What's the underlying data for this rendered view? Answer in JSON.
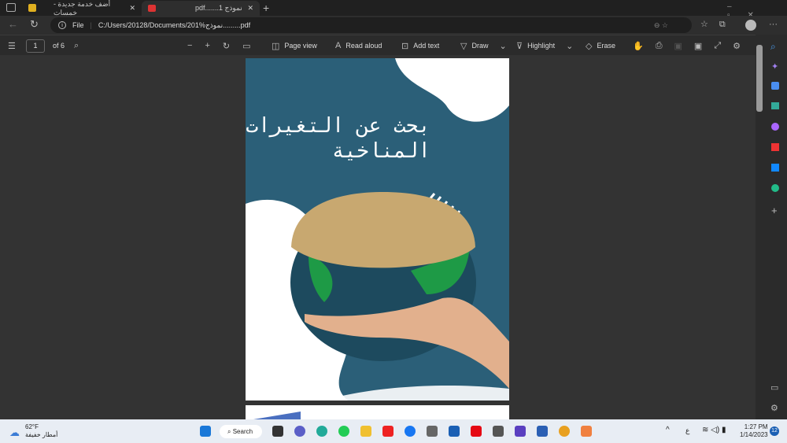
{
  "tabs": [
    {
      "title": "أضف خدمة جديدة - خمسات"
    },
    {
      "title": "pdf.......نموذج 1"
    }
  ],
  "address": {
    "scheme": "File",
    "url": "C:/Users/20128/Documents/201%نموذج.........pdf"
  },
  "pdf_toolbar": {
    "page": "1",
    "of": "of 6",
    "page_view": "Page view",
    "read_aloud": "Read aloud",
    "add_text": "Add text",
    "draw": "Draw",
    "highlight": "Highlight",
    "erase": "Erase"
  },
  "document": {
    "title_line1": "بحث عن التغيرات",
    "title_line2": "المناخية"
  },
  "taskbar": {
    "temp": "62°F",
    "weather": "أمطار خفيفة",
    "search": "Search",
    "lang": "ع",
    "time": "1:27 PM",
    "date": "1/14/2023",
    "notifications": "12"
  }
}
